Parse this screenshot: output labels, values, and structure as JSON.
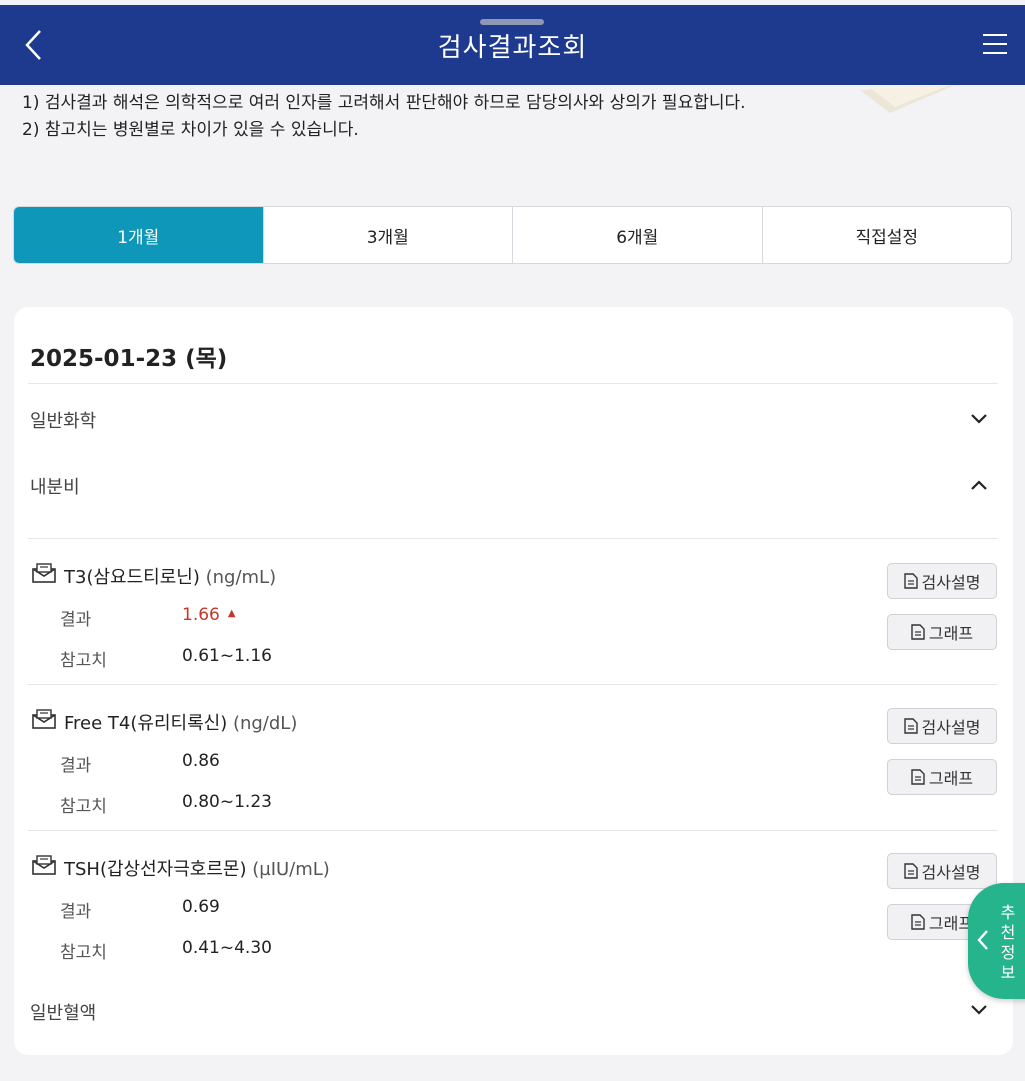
{
  "header": {
    "title": "검사결과조회",
    "back_icon": "chevron-left-icon",
    "menu_icon": "hamburger-menu-icon"
  },
  "notes": [
    "1) 검사결과 해석은 의학적으로 여러 인자를 고려해서 판단해야 하므로 담당의사와 상의가 필요합니다.",
    "2) 참고치는 병원별로 차이가 있을 수 있습니다."
  ],
  "tabs": [
    {
      "label": "1개월",
      "active": true
    },
    {
      "label": "3개월",
      "active": false
    },
    {
      "label": "6개월",
      "active": false
    },
    {
      "label": "직접설정",
      "active": false
    }
  ],
  "card": {
    "date": "2025-01-23 (목)",
    "categories": {
      "general_chem": {
        "label": "일반화학",
        "expanded": false
      },
      "endocrine": {
        "label": "내분비",
        "expanded": true
      },
      "cbc": {
        "label": "일반혈액",
        "expanded": false
      }
    },
    "result_label": "결과",
    "reference_label": "참고치",
    "explain_button": "검사설명",
    "graph_button": "그래프",
    "tests": [
      {
        "name": "T3(삼요드티로닌)",
        "unit": "(ng/mL)",
        "result": "1.66",
        "flag": "▲",
        "high": true,
        "reference": "0.61~1.16"
      },
      {
        "name": "Free T4(유리티록신)",
        "unit": "(ng/dL)",
        "result": "0.86",
        "flag": "",
        "high": false,
        "reference": "0.80~1.23"
      },
      {
        "name": "TSH(갑상선자극호르몬)",
        "unit": "(µIU/mL)",
        "result": "0.69",
        "flag": "",
        "high": false,
        "reference": "0.41~4.30"
      }
    ]
  },
  "fab": {
    "label": "추천정보"
  },
  "colors": {
    "header_bg": "#1d3a8f",
    "tab_active": "#0e97b8",
    "high_value": "#c0392b",
    "fab_bg": "#25b48c"
  }
}
